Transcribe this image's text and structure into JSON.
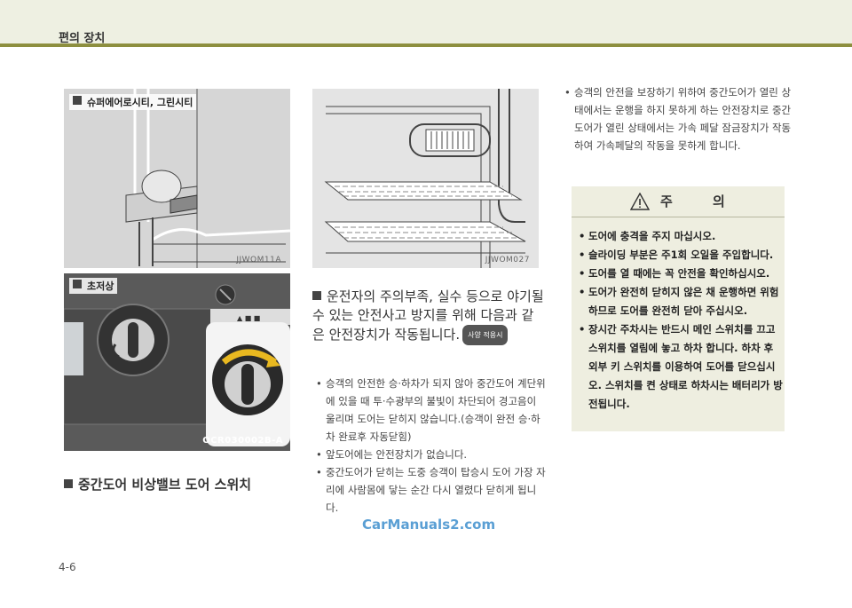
{
  "header": {
    "section": "편의 장치"
  },
  "figures": {
    "fig1": {
      "caption": "슈퍼에어로시티, 그린시티",
      "code": "JJWOM11A"
    },
    "fig2": {
      "caption": "초저상",
      "code": "OCR030002B-A"
    },
    "fig3": {
      "code": "JJWOM027"
    }
  },
  "left_heading": "중간도어 비상밸브 도어 스위치",
  "middle": {
    "heading": "운전자의 주의부족, 실수 등으로 야기될 수 있는 안전사고 방지를 위해 다음과 같은 안전장치가 작동됩니다.",
    "badge": "사양 적용시",
    "bullets": [
      "승객의 안전한 승·하차가 되지 않아 중간도어 계단위에 있을 때 투·수광부의 불빛이 차단되어 경고음이 울리며 도어는 닫히지 않습니다.(승객이 완전 승·하차 완료후 자동닫힘)",
      "앞도어에는 안전장치가 없습니다.",
      "중간도어가 닫히는 도중 승객이 탑승시 도어 가장 자리에 사람몸에 닿는 순간 다시 열렸다 닫히게 됩니다."
    ]
  },
  "right": {
    "bullets": [
      "승객의 안전을 보장하기 위하여 중간도어가 열린 상태에서는 운행을 하지 못하게 하는 안전장치로 중간도어가 열린 상태에서는 가속 페달 잠금장치가 작동하여 가속페달의 작동을 못하게 합니다."
    ]
  },
  "caution": {
    "title": "주 의",
    "items": [
      "도어에 충격을 주지 마십시오.",
      "슬라이딩 부분은 주1회 오일을 주입합니다.",
      "도어를 열 때에는 꼭 안전을 확인하십시오.",
      "도어가 완전히 닫히지 않은 채 운행하면 위험하므로 도어를 완전히 닫아 주십시오.",
      "장시간 주차시는 반드시 메인 스위치를 끄고 스위치를 열림에 놓고 하차 합니다. 하차 후 외부 키 스위치를 이용하여 도어를 닫으십시오. 스위치를 켠 상태로 하차시는 배터리가 방전됩니다."
    ]
  },
  "watermark": "CarManuals2.com",
  "page_number": "4-6"
}
